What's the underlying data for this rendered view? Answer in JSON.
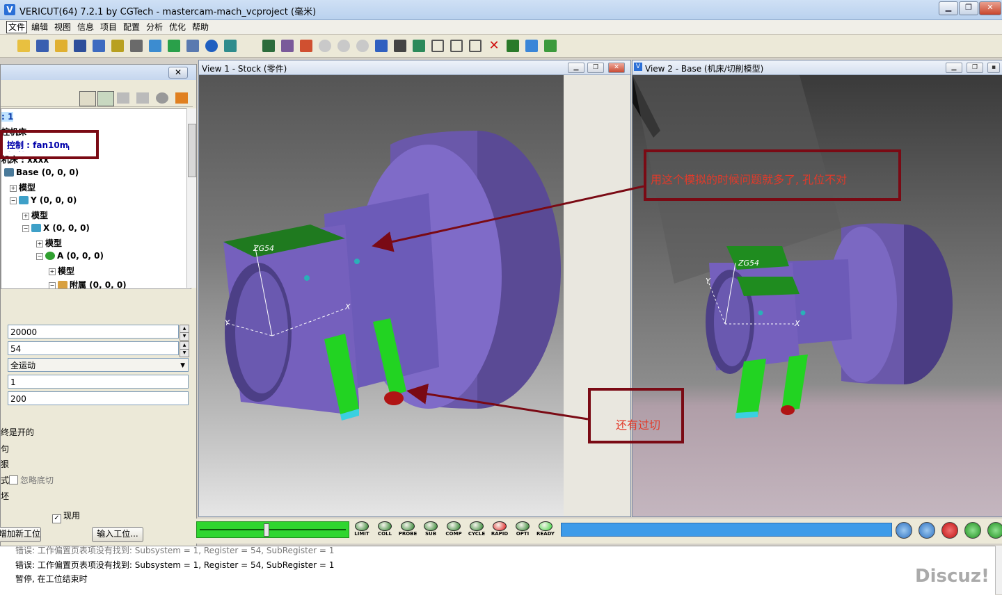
{
  "window": {
    "title": "VERICUT(64)  7.2.1 by CGTech - mastercam-mach_vcproject (毫米)",
    "app_icon": "V"
  },
  "menu": [
    "文件",
    "编辑",
    "视图",
    "信息",
    "项目",
    "配置",
    "分析",
    "优化",
    "帮助"
  ],
  "view1": {
    "title": "View 1 - Stock (零件)"
  },
  "view2": {
    "title": "View 2 - Base (机床/切削模型)"
  },
  "dialog": {
    "tree_root": ": 1",
    "tree": [
      {
        "label": "控机床"
      },
      {
        "label": "控制 : fan10m"
      },
      {
        "label": "机床 : xxxx"
      },
      {
        "label": "Base (0, 0, 0)"
      },
      {
        "label": "模型"
      },
      {
        "label": "Y (0, 0, 0)"
      },
      {
        "label": "模型"
      },
      {
        "label": "X (0, 0, 0)"
      },
      {
        "label": "模型"
      },
      {
        "label": "A (0, 0, 0)"
      },
      {
        "label": "模型"
      },
      {
        "label": "附属 (0, 0, 0)"
      }
    ],
    "fields": [
      "20000",
      "54",
      "全运动",
      "1",
      "200"
    ],
    "labels": [
      "终是开的",
      "句",
      "狠",
      "式",
      "坯"
    ],
    "ignore_undercut": "忽略底切",
    "active_label": "现用",
    "add_button": "增加新工位",
    "input_button": "输入工位..."
  },
  "leds": [
    {
      "t": "LIMIT",
      "c": "#1f7a1f"
    },
    {
      "t": "COLL",
      "c": "#1f7a1f"
    },
    {
      "t": "PROBE",
      "c": "#1f7a1f"
    },
    {
      "t": "SUB",
      "c": "#1f7a1f"
    },
    {
      "t": "COMP",
      "c": "#1f7a1f"
    },
    {
      "t": "CYCLE",
      "c": "#1f7a1f"
    },
    {
      "t": "RAPID",
      "c": "#e01010"
    },
    {
      "t": "OPTI",
      "c": "#1f7a1f"
    },
    {
      "t": "READY",
      "c": "#36d236"
    }
  ],
  "log": [
    "错误: 工作偏置页表项没有找到:  Subsystem = 1, Register = 54, SubRegister = 1",
    "错误: 工作偏置页表项没有找到:  Subsystem = 1, Register = 54, SubRegister = 1",
    "暂停, 在工位结束时"
  ],
  "annotations": {
    "note1": "用这个模拟的时候问题就多了, 孔位不对",
    "note2": "还有过切",
    "box_label": "控制 : fan10m"
  },
  "scene": {
    "label_zg54": "ZG54",
    "axis_x": "X",
    "axis_y": "Y"
  },
  "watermark": "Discuz!"
}
